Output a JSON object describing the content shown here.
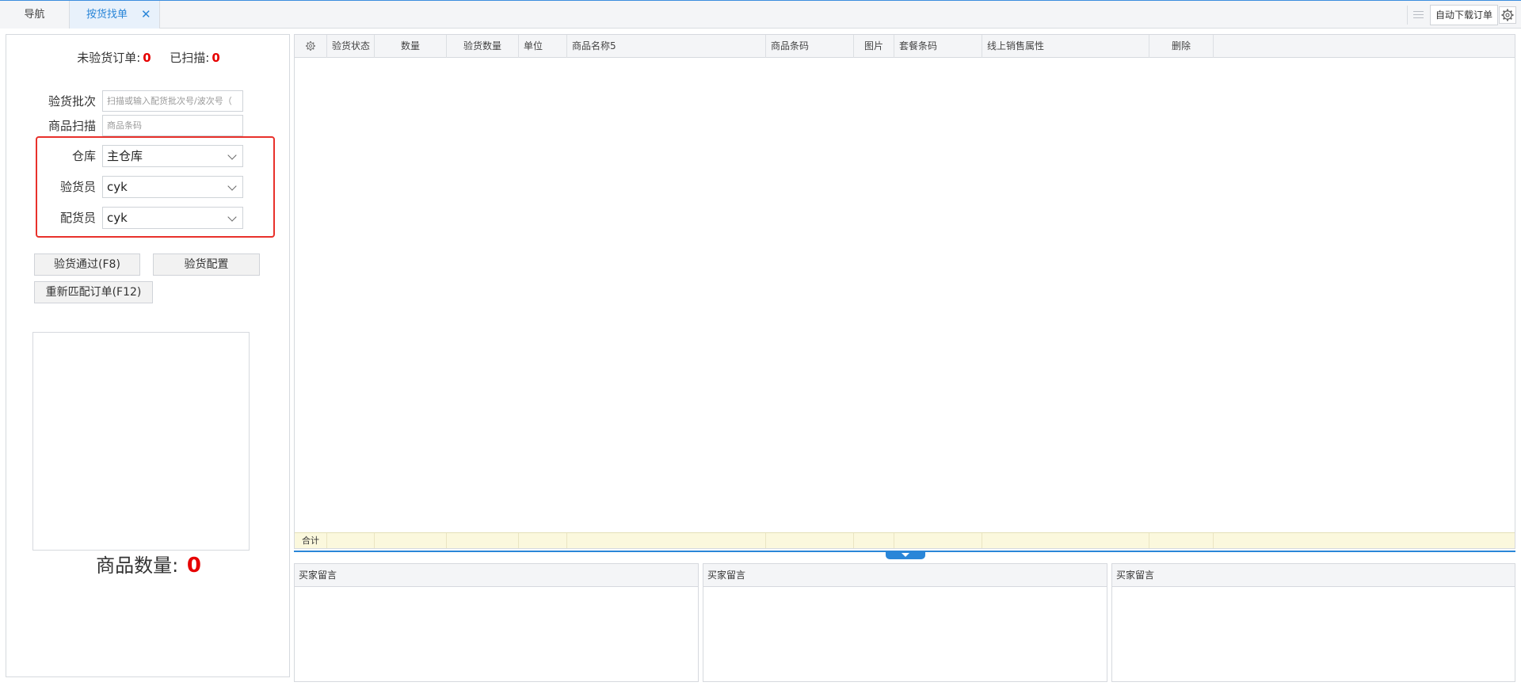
{
  "tabs": {
    "nav_label": "导航",
    "active_label": "按货找单",
    "close_glyph": "✕"
  },
  "toolbar": {
    "auto_download_label": "自动下载订单",
    "list_icon": "list-icon",
    "gear_icon": "gear-icon"
  },
  "summary": {
    "uninspected_label": "未验货订单:",
    "uninspected_value": "0",
    "scanned_label": "已扫描:",
    "scanned_value": "0"
  },
  "form": {
    "batch_label": "验货批次",
    "batch_placeholder": "扫描或输入配货批次号/波次号（",
    "scan_label": "商品扫描",
    "scan_placeholder": "商品条码",
    "warehouse_label": "仓库",
    "warehouse_value": "主仓库",
    "inspector_label": "验货员",
    "inspector_value": "cyk",
    "picker_label": "配货员",
    "picker_value": "cyk"
  },
  "actions": {
    "pass_label": "验货通过(F8)",
    "config_label": "验货配置",
    "rematch_label": "重新匹配订单(F12)"
  },
  "quantity": {
    "label": "商品数量:",
    "value": "0"
  },
  "grid": {
    "columns": [
      "验货状态",
      "数量",
      "验货数量",
      "单位",
      "商品名称5",
      "商品条码",
      "图片",
      "套餐条码",
      "线上销售属性",
      "删除"
    ],
    "rows": [],
    "footer_label": "合计"
  },
  "messages": {
    "panels": [
      "买家留言",
      "买家留言",
      "买家留言"
    ]
  },
  "colors": {
    "accent": "#2a86d8",
    "highlight": "#e8312b",
    "count_red": "#e60000"
  }
}
